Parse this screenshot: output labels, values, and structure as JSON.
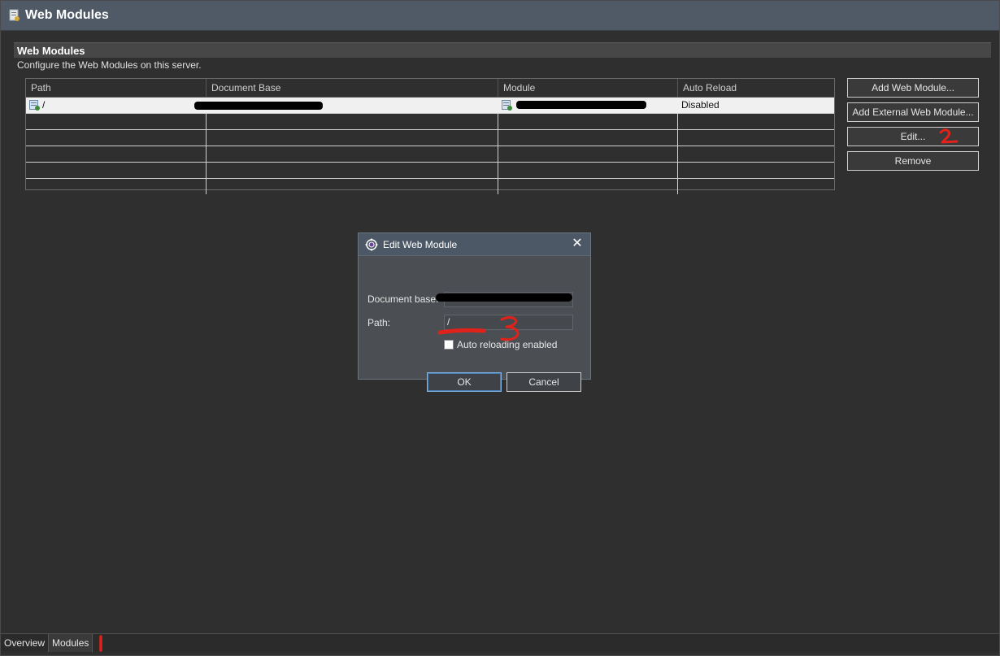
{
  "header": {
    "title": "Web Modules"
  },
  "section": {
    "title": "Web Modules",
    "description": "Configure the Web Modules on this server."
  },
  "table": {
    "columns": [
      "Path",
      "Document Base",
      "Module",
      "Auto Reload"
    ],
    "rows": [
      {
        "path": "/",
        "document_base": "",
        "module": "",
        "auto_reload": "Disabled"
      }
    ]
  },
  "side_buttons": {
    "add_web_module": "Add Web Module...",
    "add_external_web_module": "Add External Web Module...",
    "edit": "Edit...",
    "remove": "Remove"
  },
  "dialog": {
    "title": "Edit Web Module",
    "document_base_label": "Document base:",
    "document_base_value": "",
    "path_label": "Path:",
    "path_value": "/",
    "auto_reload_label": "Auto reloading enabled",
    "auto_reload_checked": false,
    "ok_label": "OK",
    "cancel_label": "Cancel"
  },
  "tabs": {
    "overview": "Overview",
    "modules": "Modules"
  },
  "annotations": {
    "edit_mark": "2",
    "checkbox_mark": "3",
    "tab_mark": "1",
    "color": "#e0221a"
  }
}
